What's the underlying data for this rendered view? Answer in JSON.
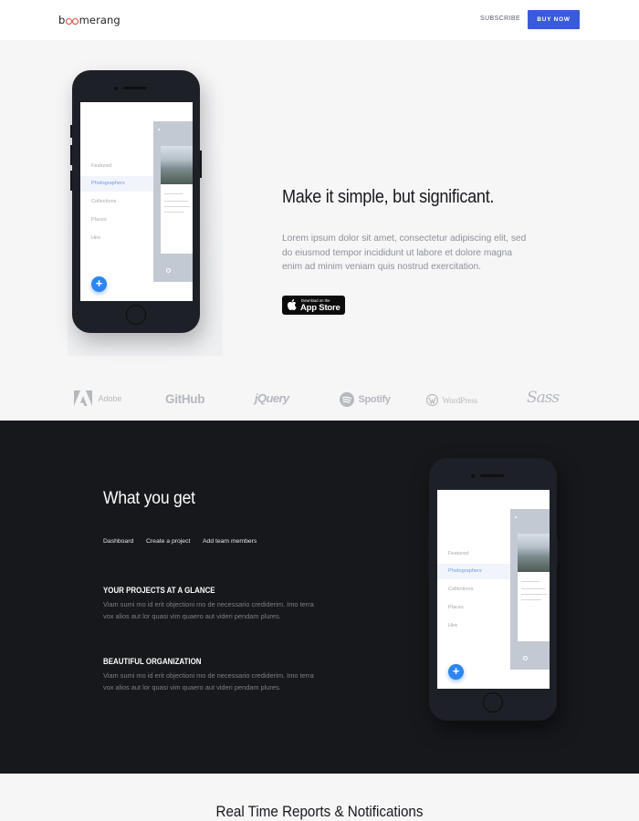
{
  "nav": {
    "logo": {
      "pre": "b",
      "post": "merang"
    },
    "subscribe": "SUBSCRIBE",
    "buy": "BUY NOW",
    "buy_color": "#3a5bd9"
  },
  "hero": {
    "title": "Make it simple, but significant.",
    "text": "Lorem ipsum dolor sit amet, consectetur adipiscing elit, sed do eiusmod tempor incididunt ut labore et dolore magna enim ad minim veniam quis nostrud exercitation.",
    "appstore": {
      "small": "Download on the",
      "big": "App Store"
    }
  },
  "phone_ui": {
    "menu": [
      "Featured",
      "Photographers",
      "Collections",
      "Places",
      "Hire"
    ],
    "active_index": 1,
    "fab": "+"
  },
  "logos": [
    "Adobe",
    "GitHub",
    "jQuery",
    "Spotify",
    "WordPress",
    "Sass"
  ],
  "features": {
    "title": "What you get",
    "tabs": [
      "Dashboard",
      "Create a project",
      "Add team members"
    ],
    "items": [
      {
        "heading": "YOUR PROJECTS AT A GLANCE",
        "text": "Viam sumi mo id erit objectioni mo de necessario crediderim. Imo terra vox alios aut lor quasi vim quaero aut videri pendam plures."
      },
      {
        "heading": "BEAUTIFUL ORGANIZATION",
        "text": "Viam sumi mo id erit objectioni mo de necessario crediderim. Imo terra vox alios aut lor quasi vim quaero aut videri pendam plures."
      }
    ]
  },
  "reports": {
    "title": "Real Time Reports & Notifications"
  }
}
